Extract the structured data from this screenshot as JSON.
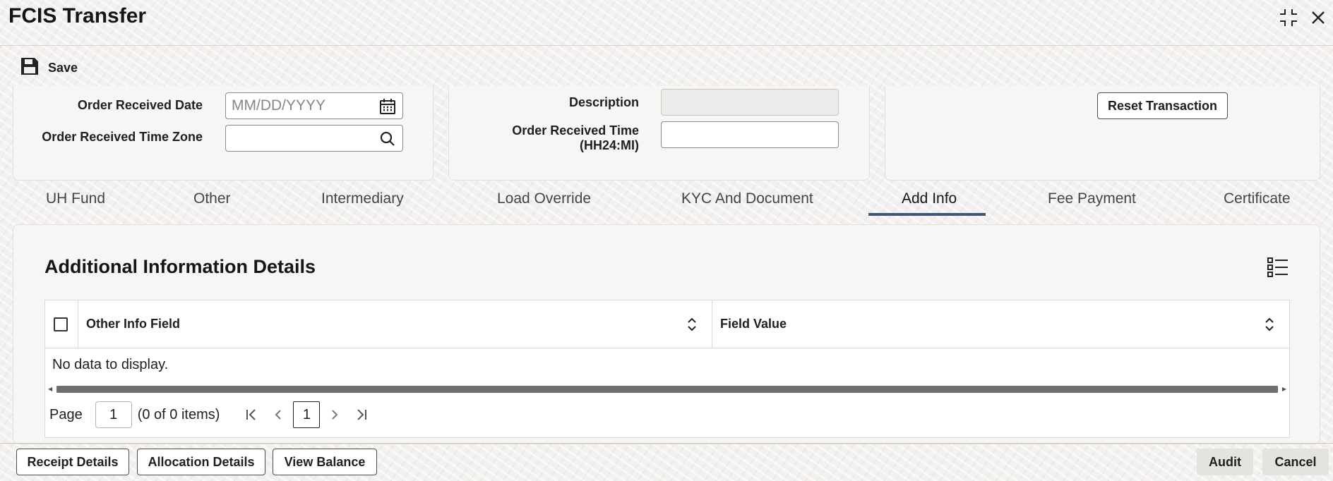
{
  "window": {
    "title": "FCIS Transfer"
  },
  "toolbar": {
    "save_label": "Save"
  },
  "order": {
    "received_date_label": "Order Received Date",
    "received_date_placeholder": "MM/DD/YYYY",
    "received_date_value": "",
    "time_zone_label": "Order Received Time Zone",
    "time_zone_value": "",
    "description_label": "Description",
    "description_value": "",
    "received_time_label_line1": "Order Received Time",
    "received_time_label_line2": "(HH24:MI)",
    "received_time_value": "",
    "reset_button": "Reset Transaction"
  },
  "tabs": [
    {
      "label": "UH Fund",
      "active": false
    },
    {
      "label": "Other",
      "active": false
    },
    {
      "label": "Intermediary",
      "active": false
    },
    {
      "label": "Load Override",
      "active": false
    },
    {
      "label": "KYC And Document",
      "active": false
    },
    {
      "label": "Add Info",
      "active": true
    },
    {
      "label": "Fee Payment",
      "active": false
    },
    {
      "label": "Certificate",
      "active": false
    }
  ],
  "section": {
    "title": "Additional Information Details"
  },
  "table": {
    "columns": [
      "Other Info Field",
      "Field Value"
    ],
    "rows": [],
    "empty_text": "No data to display."
  },
  "pagination": {
    "page_label": "Page",
    "page_value": "1",
    "items_text": "(0 of 0 items)",
    "current_page": "1"
  },
  "footer": {
    "receipt_details": "Receipt Details",
    "allocation_details": "Allocation Details",
    "view_balance": "View Balance",
    "audit": "Audit",
    "cancel": "Cancel"
  },
  "colors": {
    "active_tab_underline": "#3c5a78",
    "background": "#f3f1ef",
    "panel": "#f7f6f5"
  },
  "icons": [
    "collapse-icon",
    "close-icon",
    "save-icon",
    "calendar-icon",
    "search-icon",
    "list-view-icon",
    "sort-icon",
    "first-page-icon",
    "previous-page-icon",
    "next-page-icon",
    "last-page-icon"
  ]
}
